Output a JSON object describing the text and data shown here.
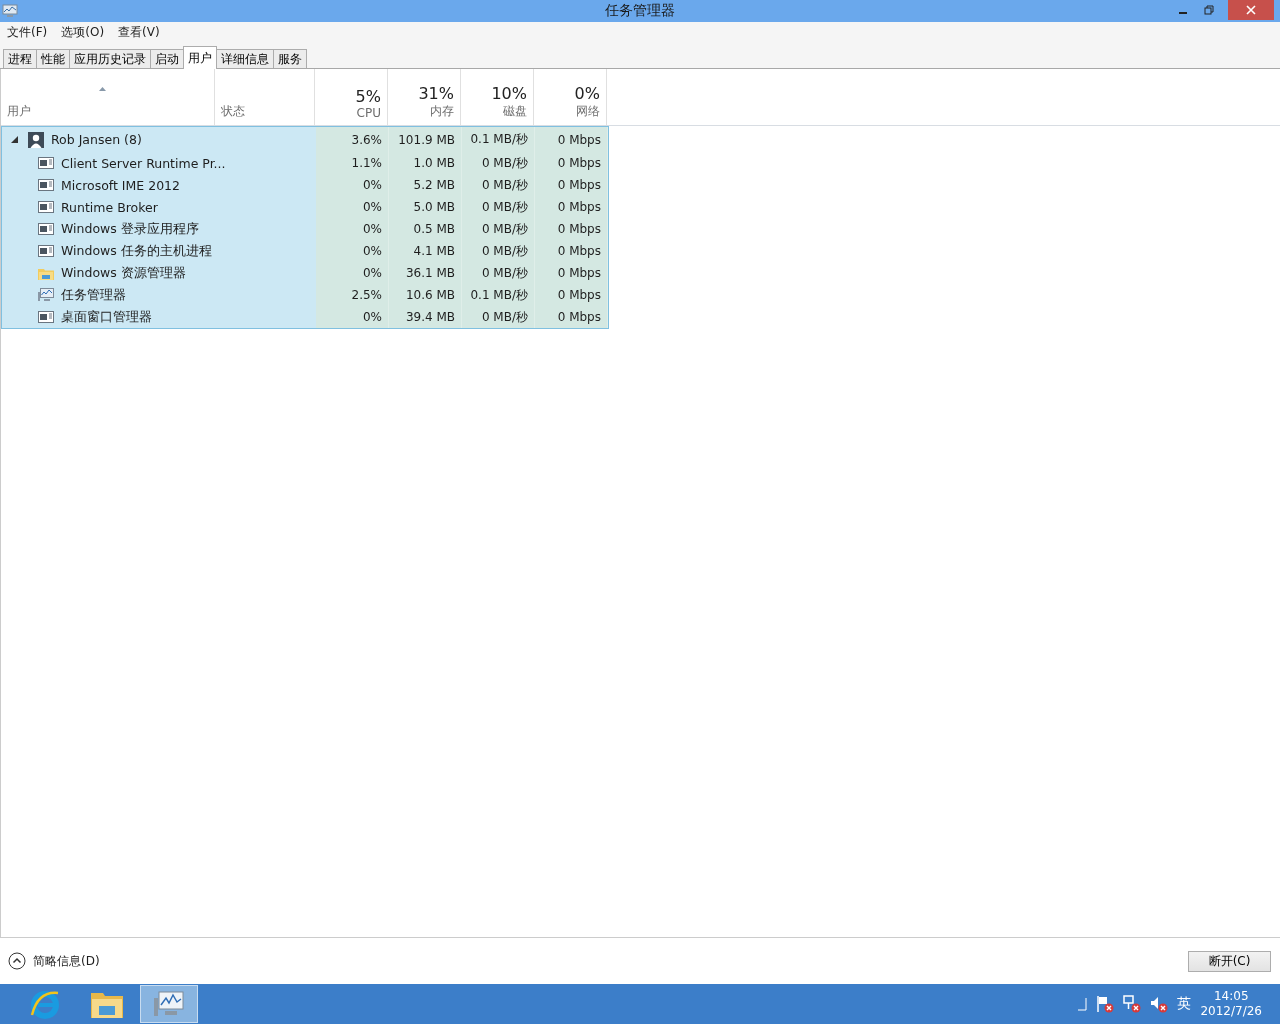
{
  "window": {
    "title": "任务管理器"
  },
  "menu": [
    "文件(F)",
    "选项(O)",
    "查看(V)"
  ],
  "tabs": [
    {
      "label": "进程",
      "selected": false
    },
    {
      "label": "性能",
      "selected": false
    },
    {
      "label": "应用历史记录",
      "selected": false
    },
    {
      "label": "启动",
      "selected": false
    },
    {
      "label": "用户",
      "selected": true
    },
    {
      "label": "详细信息",
      "selected": false
    },
    {
      "label": "服务",
      "selected": false
    }
  ],
  "columns": [
    {
      "label": "用户"
    },
    {
      "label": "状态"
    },
    {
      "label": "CPU",
      "total": "5%"
    },
    {
      "label": "内存",
      "total": "31%"
    },
    {
      "label": "磁盘",
      "total": "10%"
    },
    {
      "label": "网络",
      "total": "0%"
    }
  ],
  "users": [
    {
      "name": "Rob Jansen (8)",
      "expanded": true,
      "selected": true,
      "cpu": "3.6%",
      "memory": "101.9 MB",
      "disk": "0.1 MB/秒",
      "network": "0 Mbps",
      "children": [
        {
          "name": "Client Server Runtime Pr...",
          "kind": "app",
          "cpu": "1.1%",
          "memory": "1.0 MB",
          "disk": "0 MB/秒",
          "network": "0 Mbps"
        },
        {
          "name": "Microsoft IME 2012",
          "kind": "app",
          "cpu": "0%",
          "memory": "5.2 MB",
          "disk": "0 MB/秒",
          "network": "0 Mbps"
        },
        {
          "name": "Runtime Broker",
          "kind": "app",
          "cpu": "0%",
          "memory": "5.0 MB",
          "disk": "0 MB/秒",
          "network": "0 Mbps"
        },
        {
          "name": "Windows 登录应用程序",
          "kind": "app",
          "cpu": "0%",
          "memory": "0.5 MB",
          "disk": "0 MB/秒",
          "network": "0 Mbps"
        },
        {
          "name": "Windows 任务的主机进程",
          "kind": "app",
          "cpu": "0%",
          "memory": "4.1 MB",
          "disk": "0 MB/秒",
          "network": "0 Mbps"
        },
        {
          "name": "Windows 资源管理器",
          "kind": "explorer",
          "cpu": "0%",
          "memory": "36.1 MB",
          "disk": "0 MB/秒",
          "network": "0 Mbps"
        },
        {
          "name": "任务管理器",
          "kind": "monitor",
          "cpu": "2.5%",
          "memory": "10.6 MB",
          "disk": "0.1 MB/秒",
          "network": "0 Mbps"
        },
        {
          "name": "桌面窗口管理器",
          "kind": "app",
          "cpu": "0%",
          "memory": "39.4 MB",
          "disk": "0 MB/秒",
          "network": "0 Mbps"
        }
      ]
    }
  ],
  "footer": {
    "details_toggle": "简略信息(D)",
    "disconnect_button": "断开(C)"
  },
  "taskbar": {
    "apps": [
      {
        "kind": "browser",
        "selected": false
      },
      {
        "kind": "explorer",
        "selected": false
      },
      {
        "kind": "monitor",
        "selected": true
      }
    ],
    "language": "英",
    "time": "14:05",
    "date": "2012/7/26"
  }
}
